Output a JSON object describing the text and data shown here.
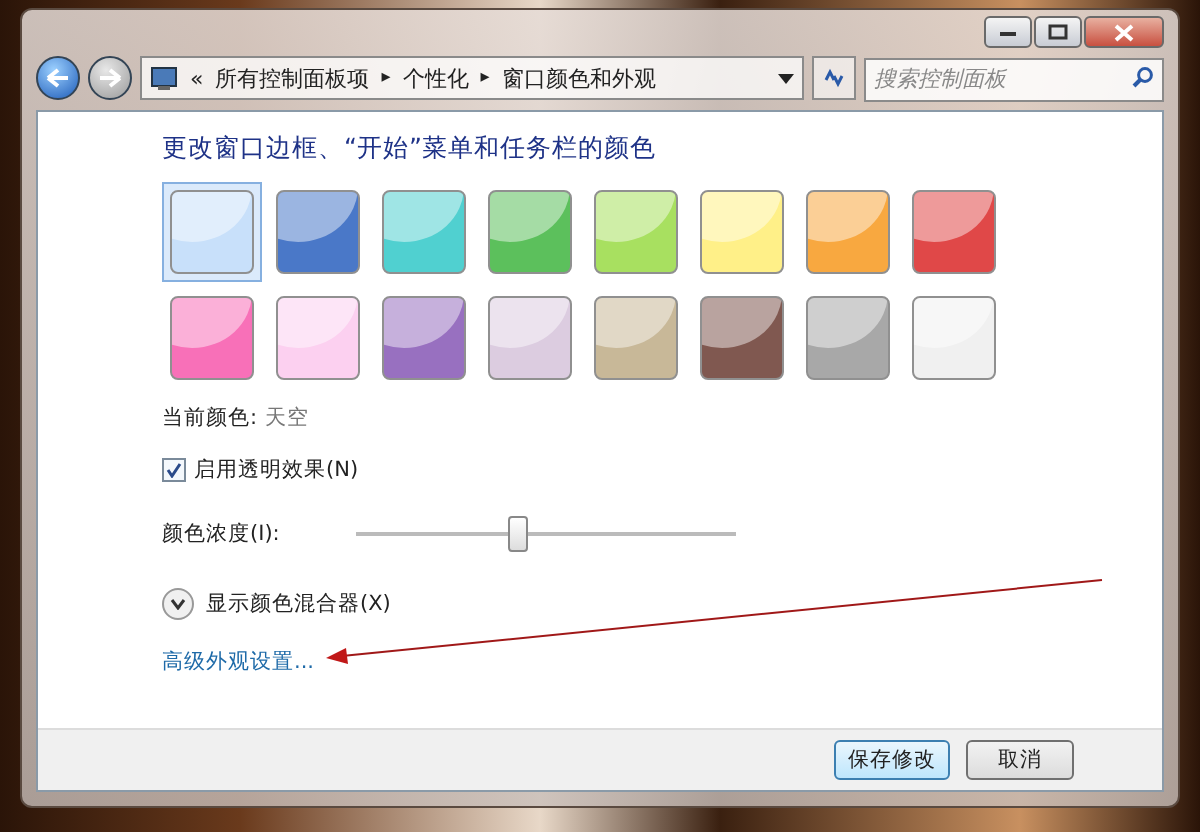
{
  "address_bar": {
    "overflow": "«",
    "crumbs": [
      "所有控制面板项",
      "个性化",
      "窗口颜色和外观"
    ],
    "separator": "▸"
  },
  "search": {
    "placeholder": "搜索控制面板"
  },
  "heading": "更改窗口边框、“开始”菜单和任务栏的颜色",
  "swatches": [
    {
      "color": "#c8e0fa",
      "selected": true
    },
    {
      "color": "#4a78c8",
      "selected": false
    },
    {
      "color": "#50d0d0",
      "selected": false
    },
    {
      "color": "#5cc05c",
      "selected": false
    },
    {
      "color": "#a8e060",
      "selected": false
    },
    {
      "color": "#fff088",
      "selected": false
    },
    {
      "color": "#f8a840",
      "selected": false
    },
    {
      "color": "#e04848",
      "selected": false
    },
    {
      "color": "#f870b8",
      "selected": false
    },
    {
      "color": "#fcd0f0",
      "selected": false
    },
    {
      "color": "#9870c0",
      "selected": false
    },
    {
      "color": "#dccce0",
      "selected": false
    },
    {
      "color": "#c8b898",
      "selected": false
    },
    {
      "color": "#805850",
      "selected": false
    },
    {
      "color": "#a8a8a8",
      "selected": false
    },
    {
      "color": "#f0f0f0",
      "selected": false
    }
  ],
  "current_color": {
    "label": "当前颜色:",
    "value": "天空"
  },
  "transparency": {
    "label": "启用透明效果(N)",
    "checked": true
  },
  "intensity": {
    "label": "颜色浓度(I):",
    "level": 0.42
  },
  "mixer": {
    "label": "显示颜色混合器(X)",
    "expanded": false
  },
  "advanced_link": "高级外观设置...",
  "buttons": [
    {
      "label": "保存修改",
      "kind": "default"
    },
    {
      "label": "取消",
      "kind": "normal"
    }
  ]
}
